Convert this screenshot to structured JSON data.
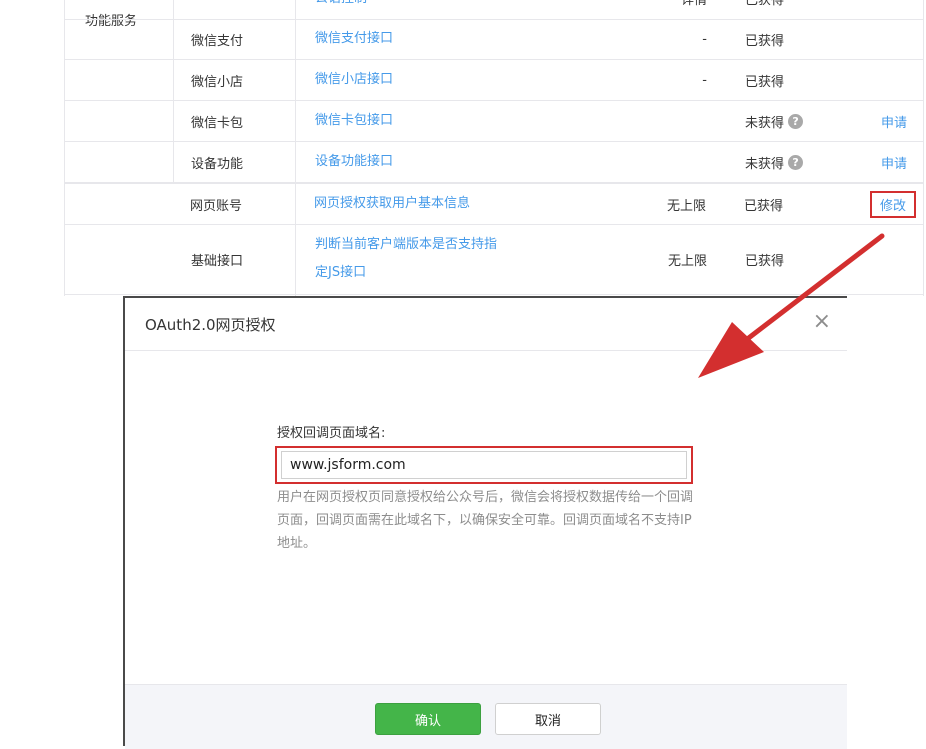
{
  "table": {
    "section_label": "功能服务",
    "rows": [
      {
        "category": "",
        "name": "公语控制",
        "limit": "详情",
        "status": "已获得",
        "op": ""
      },
      {
        "category": "微信支付",
        "name": "微信支付接口",
        "limit": "-",
        "status": "已获得",
        "op": ""
      },
      {
        "category": "微信小店",
        "name": "微信小店接口",
        "limit": "-",
        "status": "已获得",
        "op": ""
      },
      {
        "category": "微信卡包",
        "name": "微信卡包接口",
        "limit": "",
        "status": "未获得",
        "op": "申请"
      },
      {
        "category": "设备功能",
        "name": "设备功能接口",
        "limit": "",
        "status": "未获得",
        "op": "申请"
      },
      {
        "category": "网页账号",
        "name": "网页授权获取用户基本信息",
        "limit": "无上限",
        "status": "已获得",
        "op": "修改"
      },
      {
        "category": "基础接口",
        "name_line1": "判断当前客户端版本是否支持指",
        "name_line2": "定JS接口",
        "limit": "无上限",
        "status": "已获得",
        "op": ""
      }
    ],
    "help_glyph": "?"
  },
  "dialog": {
    "title": "OAuth2.0网页授权",
    "close_glyph": "×",
    "field_label": "授权回调页面域名:",
    "field_value": "www.jsform.com",
    "tip": "用户在网页授权页同意授权给公众号后，微信会将授权数据传给一个回调页面，回调页面需在此域名下，以确保安全可靠。回调页面域名不支持IP地址。",
    "confirm_label": "确认",
    "cancel_label": "取消",
    "colors": {
      "confirm": "#44b549",
      "highlight": "#d32f2f",
      "link": "#459ae9"
    }
  }
}
